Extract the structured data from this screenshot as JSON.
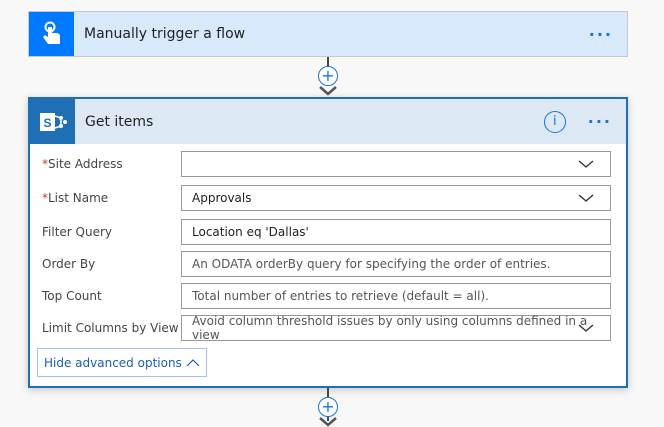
{
  "trigger": {
    "title": "Manually trigger a flow",
    "icon": "hand-pointer-icon",
    "menu": "···"
  },
  "action": {
    "title": "Get items",
    "icon": "sharepoint-icon",
    "info": "i",
    "menu": "···",
    "fields": [
      {
        "label": "Site Address",
        "required": true,
        "value": "",
        "dropdown": true
      },
      {
        "label": "List Name",
        "required": true,
        "value": "Approvals",
        "dropdown": true
      },
      {
        "label": "Filter Query",
        "required": false,
        "value": "Location eq 'Dallas'",
        "dropdown": false
      },
      {
        "label": "Order By",
        "required": false,
        "placeholder": "An ODATA orderBy query for specifying the order of entries.",
        "dropdown": false
      },
      {
        "label": "Top Count",
        "required": false,
        "placeholder": "Total number of entries to retrieve (default = all).",
        "dropdown": false
      },
      {
        "label": "Limit Columns by View",
        "required": false,
        "placeholder": "Avoid column threshold issues by only using columns defined in a view",
        "dropdown": true
      }
    ],
    "required_mark": "*",
    "hide_advanced": "Hide advanced options"
  },
  "connector": {
    "plus": "+"
  },
  "colors": {
    "accent": "#1a73d9",
    "sharepoint": "#1f6fb5",
    "trigger": "#0078ff"
  }
}
